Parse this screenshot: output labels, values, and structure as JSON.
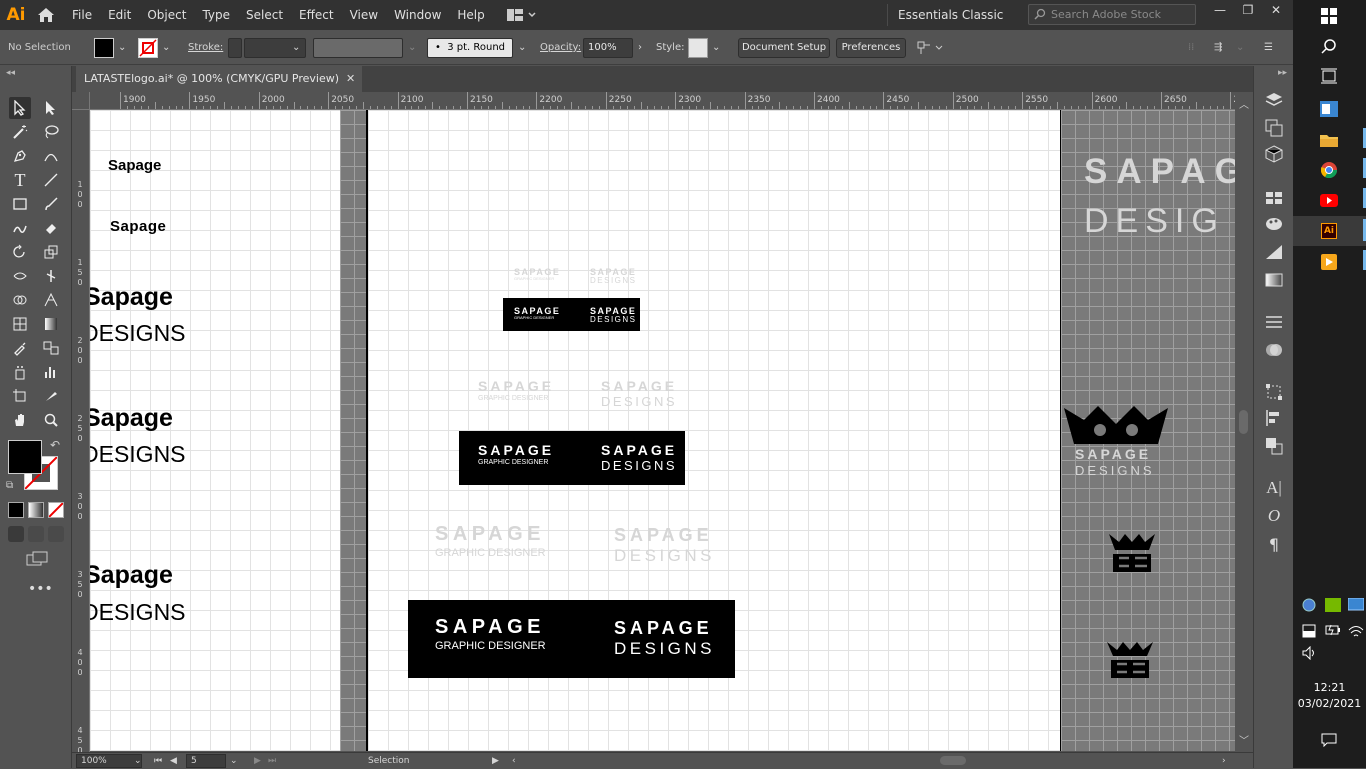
{
  "app": {
    "logo": "Ai",
    "title_icon": "home-icon"
  },
  "menu": [
    "File",
    "Edit",
    "Object",
    "Type",
    "Select",
    "Effect",
    "View",
    "Window",
    "Help"
  ],
  "workspace": {
    "label": "Essentials Classic"
  },
  "search": {
    "placeholder": "Search Adobe Stock"
  },
  "control_bar": {
    "selection_status": "No Selection",
    "stroke_label": "Stroke:",
    "brush_label": "3 pt. Round",
    "opacity_label": "Opacity:",
    "opacity_value": "100%",
    "style_label": "Style:",
    "document_setup": "Document Setup",
    "preferences": "Preferences"
  },
  "document_tab": {
    "title": "LATASTElogo.ai* @ 100% (CMYK/GPU Preview)",
    "close": "✕"
  },
  "ruler": {
    "h_labels": [
      "1900",
      "1950",
      "2000",
      "2050",
      "2100",
      "2150",
      "2200",
      "2250",
      "2300",
      "2350",
      "2400",
      "2450",
      "2500",
      "2550",
      "2600",
      "2650",
      "2"
    ],
    "v_labels": [
      "1\n0\n0",
      "1\n5\n0",
      "2\n0\n0",
      "2\n5\n0",
      "3\n0\n0",
      "3\n5\n0",
      "4\n0\n0",
      "4\n5\n0"
    ]
  },
  "canvas": {
    "left_texts": [
      "Sapage",
      "Sapage",
      "Sapage",
      "DESIGNS",
      "Sapage",
      "DESIGNS",
      "Sapage",
      "DESIGNS"
    ],
    "logos": {
      "title": "SAPAGE",
      "sub_graphic": "GRAPHIC DESIGNER",
      "sub_designs": "DESIGNS"
    },
    "right_texts": {
      "big_title": "SAPAG",
      "big_sub": "DESIG",
      "crown_title": "SAPAGE",
      "crown_sub": "DESIGNS"
    }
  },
  "status_bar": {
    "zoom": "100%",
    "artboard": "5",
    "tool": "Selection"
  },
  "clock": {
    "time": "12:21",
    "date": "03/02/2021"
  }
}
